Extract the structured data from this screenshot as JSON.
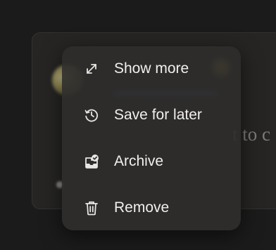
{
  "background": {
    "partial_text": "t to c"
  },
  "menu": {
    "items": [
      {
        "label": "Show more",
        "icon": "expand-arrows-icon"
      },
      {
        "label": "Save for later",
        "icon": "clock-history-icon"
      },
      {
        "label": "Archive",
        "icon": "archive-box-check-icon"
      },
      {
        "label": "Remove",
        "icon": "trash-icon"
      }
    ]
  },
  "colors": {
    "page_bg": "#1c1b1b",
    "menu_bg": "#2e2d2c",
    "text": "#f2efec",
    "icon": "#e8e5e2"
  }
}
